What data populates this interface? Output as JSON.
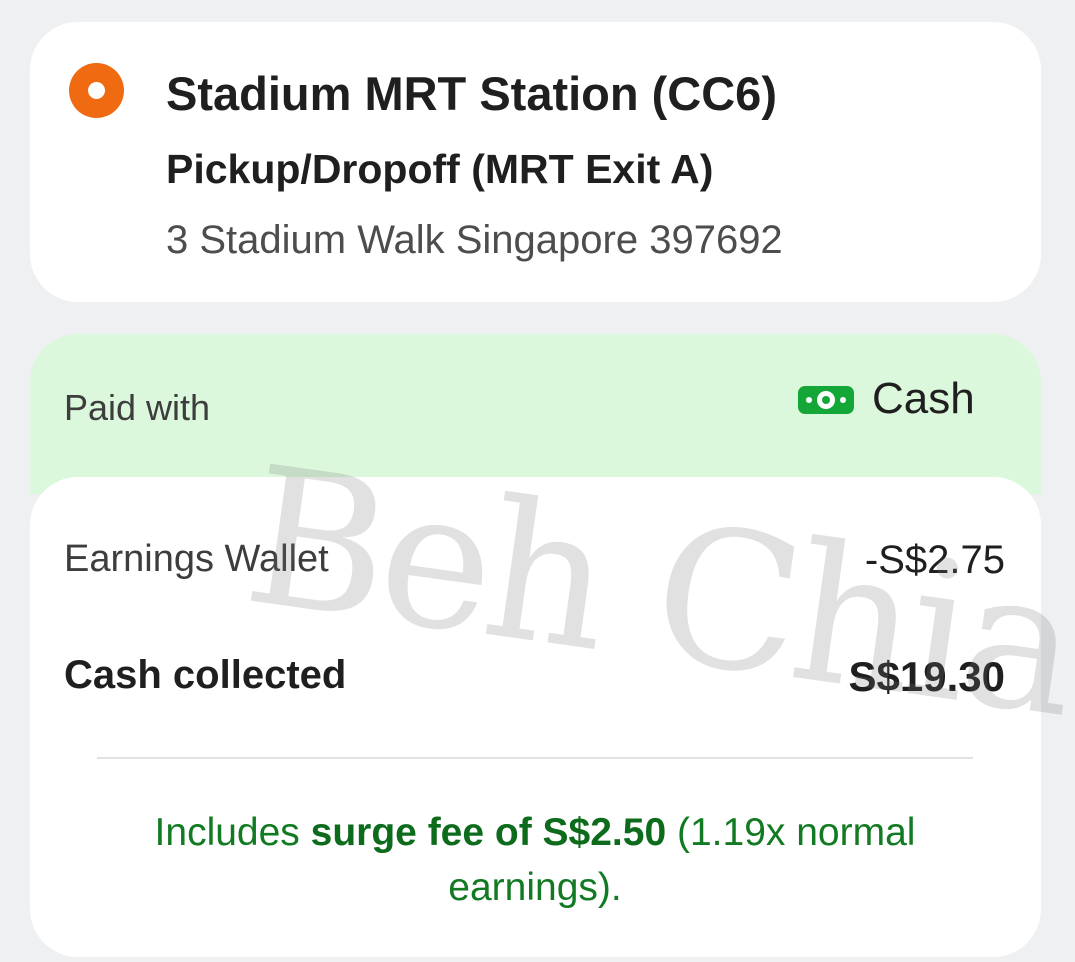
{
  "location": {
    "title": "Stadium MRT Station (CC6)",
    "subtitle": "Pickup/Dropoff (MRT Exit A)",
    "address": "3 Stadium Walk Singapore 397692",
    "marker_color": "#ef6a10"
  },
  "payment": {
    "label": "Paid with",
    "method_icon": "cash-bill-icon",
    "method": "Cash",
    "panel_color": "#dbf8dc",
    "icon_color": "#14a637"
  },
  "earnings": {
    "wallet_label": "Earnings Wallet",
    "wallet_value": "-S$2.75",
    "cash_label": "Cash collected",
    "cash_value": "S$19.30"
  },
  "surge": {
    "prefix": "Includes ",
    "highlight": "surge fee of S$2.50",
    "suffix": " (1.19x normal earnings).",
    "color": "#127a22"
  },
  "watermark": "Beh Chia Lor"
}
